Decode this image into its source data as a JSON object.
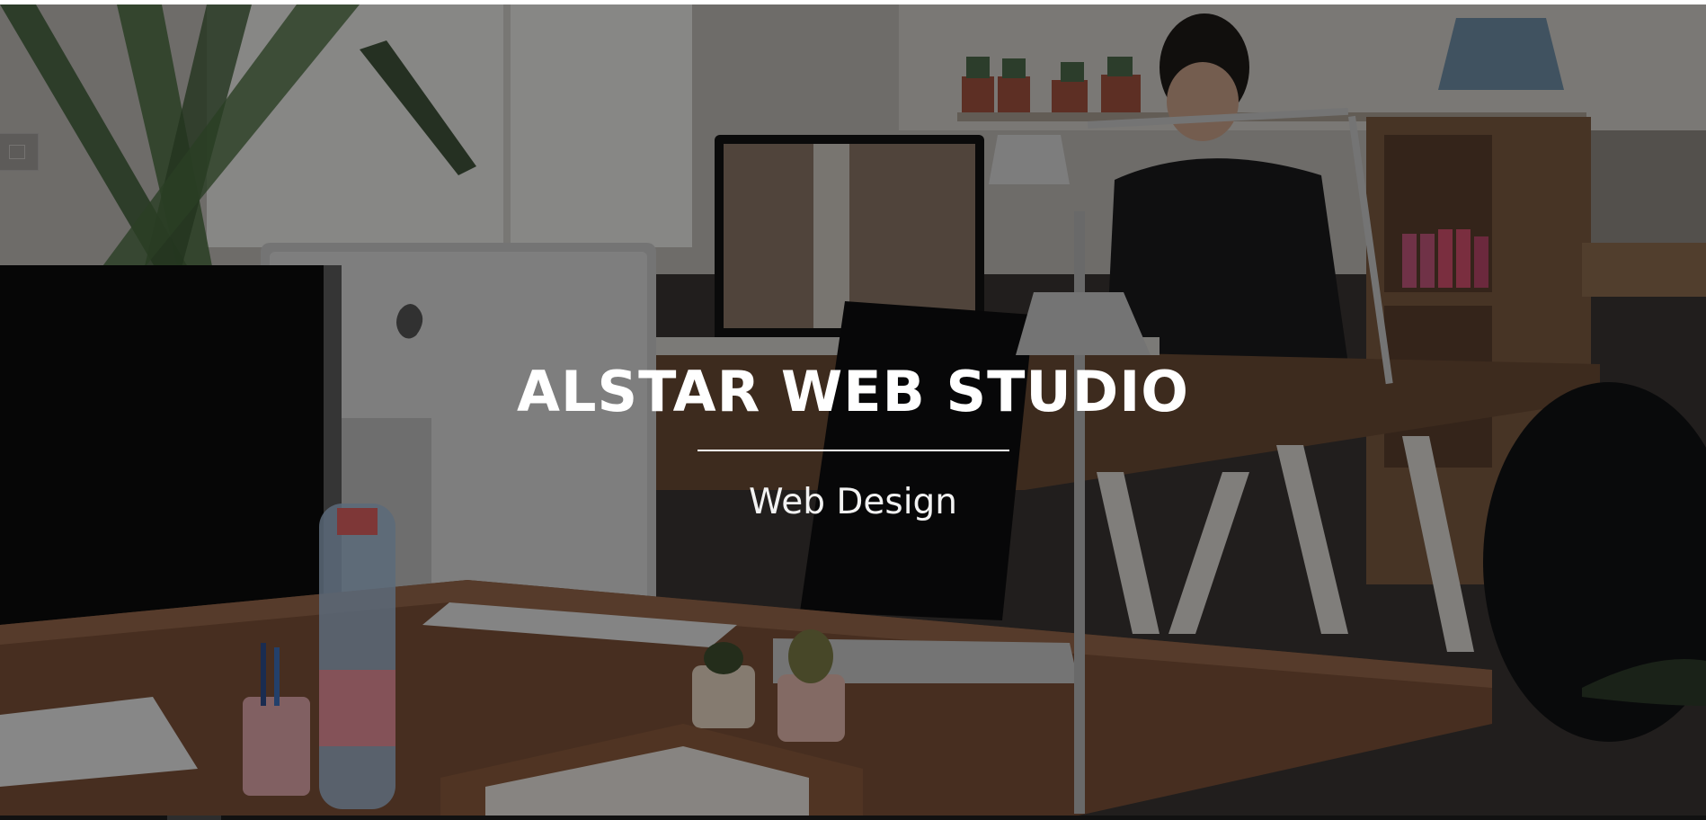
{
  "hero": {
    "title": "ALSTAR WEB STUDIO",
    "subtitle": "Web Design"
  },
  "colors": {
    "overlay": "#000000",
    "text": "#ffffff"
  }
}
